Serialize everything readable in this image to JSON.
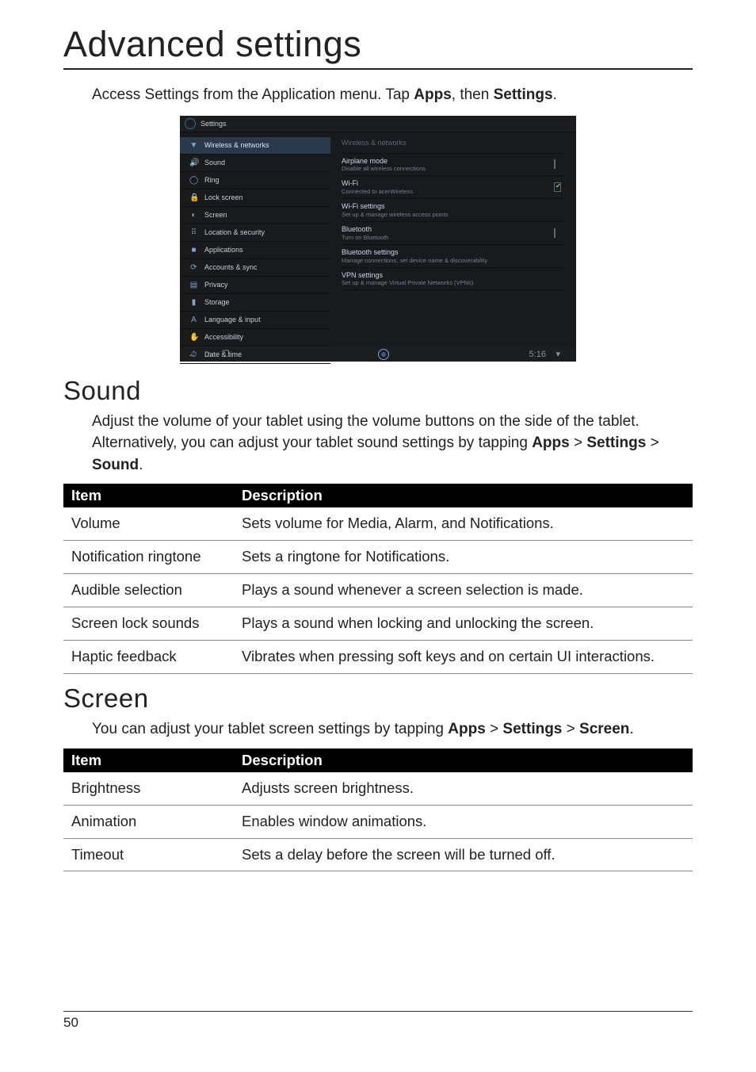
{
  "page_title": "Advanced settings",
  "intro": {
    "prefix": "Access Settings from the Application menu. Tap ",
    "apps": "Apps",
    "mid": ", then ",
    "settings": "Settings",
    "suffix": "."
  },
  "screenshot": {
    "topbar": {
      "title": "Settings"
    },
    "sidebar": [
      {
        "icon": "▼",
        "label": "Wireless & networks",
        "selected": true
      },
      {
        "icon": "🔊",
        "label": "Sound"
      },
      {
        "icon": "◯",
        "label": "Ring"
      },
      {
        "icon": "🔒",
        "label": "Lock screen"
      },
      {
        "icon": "◐",
        "label": "Screen"
      },
      {
        "icon": "⠿",
        "label": "Location & security"
      },
      {
        "icon": "■",
        "label": "Applications"
      },
      {
        "icon": "⟳",
        "label": "Accounts & sync"
      },
      {
        "icon": "▤",
        "label": "Privacy"
      },
      {
        "icon": "▮",
        "label": "Storage"
      },
      {
        "icon": "A",
        "label": "Language & input"
      },
      {
        "icon": "✋",
        "label": "Accessibility"
      },
      {
        "icon": "⏱",
        "label": "Date & time"
      }
    ],
    "detail_header": "Wireless & networks",
    "detail_rows": [
      {
        "title": "Airplane mode",
        "subtitle": "Disable all wireless connections",
        "checkbox": false
      },
      {
        "title": "Wi-Fi",
        "subtitle": "Connected to acerWireless",
        "checkbox": true
      },
      {
        "title": "Wi-Fi settings",
        "subtitle": "Set up & manage wireless access points"
      },
      {
        "title": "Bluetooth",
        "subtitle": "Turn on Bluetooth",
        "checkbox": false
      },
      {
        "title": "Bluetooth settings",
        "subtitle": "Manage connections, set device name & discoverability"
      },
      {
        "title": "VPN settings",
        "subtitle": "Set up & manage Virtual Private Networks (VPNs)"
      }
    ],
    "navbar": {
      "back": "←",
      "home": "⌂",
      "recent": "❐",
      "clock": "5:16",
      "status_wifi": "▾"
    }
  },
  "sound": {
    "heading": "Sound",
    "text_prefix": "Adjust the volume of your tablet using the volume buttons on the side of the tablet. Alternatively, you can adjust your tablet sound settings by tapping ",
    "apps": "Apps",
    "gt1": " > ",
    "settings": "Settings",
    "gt2": " > ",
    "sound": "Sound",
    "suffix": "."
  },
  "sound_table": {
    "headers": {
      "item": "Item",
      "desc": "Description"
    },
    "rows": [
      {
        "item": "Volume",
        "desc": "Sets volume for Media, Alarm, and Notifications."
      },
      {
        "item": "Notification ringtone",
        "desc": "Sets a ringtone for Notifications."
      },
      {
        "item": "Audible selection",
        "desc": "Plays a sound whenever a screen selection is made."
      },
      {
        "item": "Screen lock sounds",
        "desc": "Plays a sound when locking and unlocking the screen."
      },
      {
        "item": "Haptic feedback",
        "desc": "Vibrates when pressing soft keys and on certain UI interactions."
      }
    ]
  },
  "screen": {
    "heading": "Screen",
    "text_prefix": "You can adjust your tablet screen settings by tapping ",
    "apps": "Apps",
    "gt1": " > ",
    "settings": "Settings",
    "gt2": " > ",
    "screen": "Screen",
    "suffix": "."
  },
  "screen_table": {
    "headers": {
      "item": "Item",
      "desc": "Description"
    },
    "rows": [
      {
        "item": "Brightness",
        "desc": "Adjusts screen brightness."
      },
      {
        "item": "Animation",
        "desc": "Enables window animations."
      },
      {
        "item": "Timeout",
        "desc": "Sets a delay before the screen will be turned off."
      }
    ]
  },
  "page_number": "50"
}
